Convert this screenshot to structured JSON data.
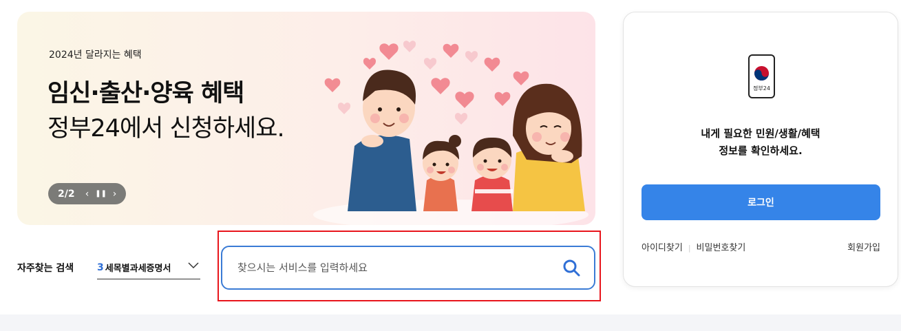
{
  "banner": {
    "subtitle": "2024년 달라지는 혜택",
    "title": "임신·출산·양육 혜택",
    "description": "정부24에서 신청하세요.",
    "pager": {
      "count": "2/2",
      "prev_icon": "chevron-left-icon",
      "pause_icon": "pause-icon",
      "next_icon": "chevron-right-icon"
    }
  },
  "search": {
    "favorite_label": "자주찾는 검색",
    "favorite_rank": "3",
    "favorite_term": "세목별과세증명서",
    "placeholder": "찾으시는 서비스를 입력하세요",
    "value": ""
  },
  "login_card": {
    "app_icon_label": "정부24",
    "message_line1": "내게 필요한 민원/생활/혜택",
    "message_line2": "정보를 확인하세요.",
    "login_button": "로그인",
    "find_id": "아이디찾기",
    "find_password": "비밀번호찾기",
    "sign_up": "회원가입"
  },
  "colors": {
    "accent": "#3584e8",
    "search_border": "#3a7bd5",
    "highlight": "#e8141b",
    "pager_bg": "#7b7b78"
  }
}
